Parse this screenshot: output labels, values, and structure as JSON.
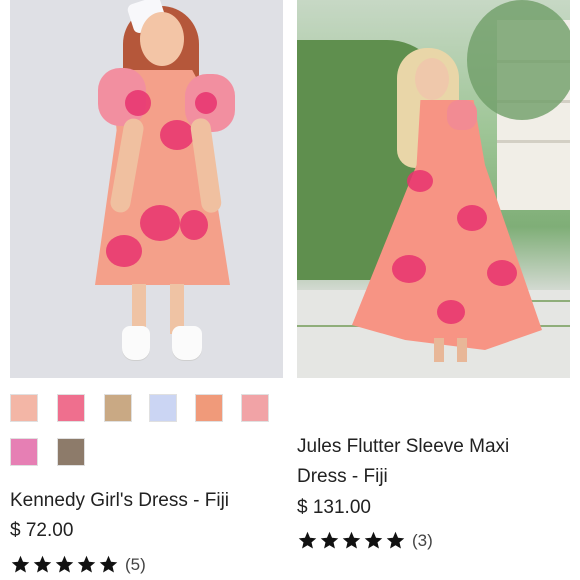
{
  "products": [
    {
      "title": "Kennedy Girl's Dress - Fiji",
      "price": "$ 72.00",
      "review_count": "(5)",
      "rating": 5,
      "swatch_colors": [
        "#f3b6a6",
        "#ef6f8e",
        "#c9a984",
        "#cbd5f3",
        "#f09a7a",
        "#f1a3a6",
        "#e67fb4",
        "#8d7b6a"
      ]
    },
    {
      "title_line1": "Jules Flutter Sleeve Maxi",
      "title_line2": "Dress - Fiji",
      "price": "$ 131.00",
      "review_count": "(3)",
      "rating": 5
    }
  ],
  "colors": {
    "star": "#111111",
    "dress_pink": "#f4a08a",
    "flower_magenta": "#e8326e"
  }
}
